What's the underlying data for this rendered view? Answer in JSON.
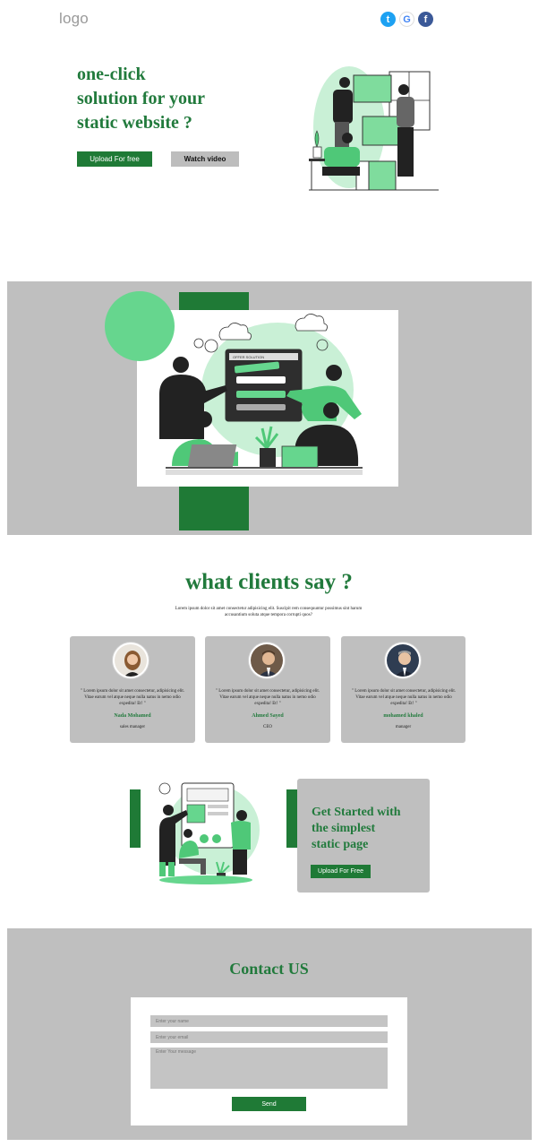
{
  "header": {
    "logo": "logo",
    "social": [
      {
        "icon": "twitter-icon",
        "glyph": "t"
      },
      {
        "icon": "google-icon",
        "glyph": "G"
      },
      {
        "icon": "facebook-icon",
        "glyph": "f"
      }
    ]
  },
  "hero": {
    "title_line1": "one-click",
    "title_line2": "solution for your",
    "title_line3": "static website ?",
    "upload_label": "Upload For free",
    "watch_label": "Watch video"
  },
  "showcase": {
    "window_title": "OFFER SOLUTION"
  },
  "testimonials": {
    "title": "what clients say ?",
    "intro_line1": "Lorem ipsum dolor sit amet consectetur adipisicing elit. Suscipit rem consequuntur possimus sint harum",
    "intro_line2": "accusantium soluta atque tempora corrupti quos?",
    "cards": [
      {
        "quote": "\" Lorem ipsum dolor sit amet consectetur, adipisicing elit. Vitae earum vel atque neque nulla natus in nemo odio expedita! Et! \"",
        "name": "Nada Mohamed",
        "role": "sales manager"
      },
      {
        "quote": "\" Lorem ipsum dolor sit amet consectetur, adipisicing elit. Vitae earum vel atque neque nulla natus in nemo odio expedita! Et! \"",
        "name": "Ahmed Sayed",
        "role": "CEO"
      },
      {
        "quote": "\" Lorem ipsum dolor sit amet consectetur, adipisicing elit. Vitae earum vel atque neque nulla natus in nemo odio expedita! Et! \"",
        "name": "mohamed khaled",
        "role": "manager"
      }
    ]
  },
  "cta": {
    "title_line1": "Get Started with",
    "title_line2": "the simplest",
    "title_line3": "static page",
    "button_label": "Upload For Free"
  },
  "contact": {
    "title": "Contact US",
    "name_placeholder": "Enter your name",
    "email_placeholder": "Enter your email",
    "message_placeholder": "Enter Your message",
    "send_label": "Send"
  },
  "colors": {
    "brand_green": "#1f7a36",
    "light_green": "#66d68e",
    "grey_band": "#bfbfbf"
  }
}
